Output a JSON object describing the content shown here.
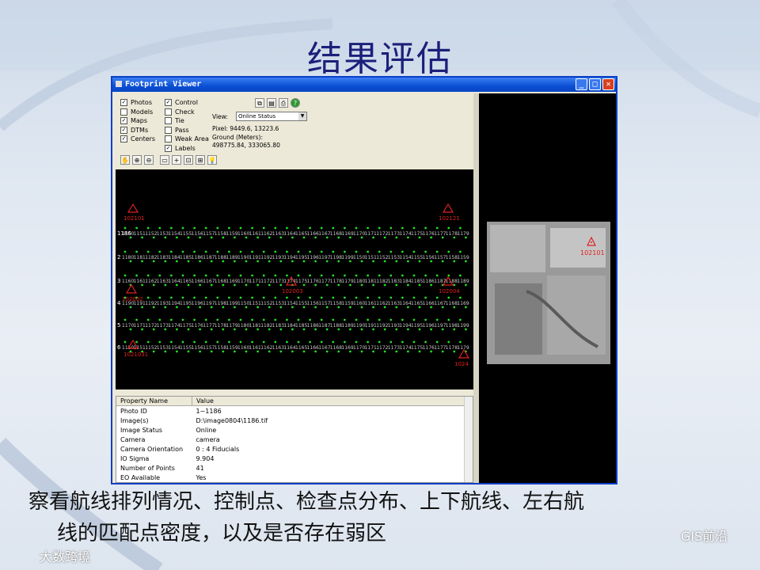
{
  "slide": {
    "title": "结果评估",
    "caption_line1": "察看航线排列情况、控制点、检查点分布、上下航线、左右航",
    "caption_line2": "线的匹配点密度，以及是否存在弱区",
    "watermark_left": "大数跨境",
    "watermark_right": "GIS前沿"
  },
  "window": {
    "title": "Footprint Viewer",
    "min": "_",
    "max": "□",
    "close": "✕"
  },
  "layers_col1": [
    {
      "label": "Photos",
      "checked": true
    },
    {
      "label": "Models",
      "checked": false
    },
    {
      "label": "Maps",
      "checked": true
    },
    {
      "label": "DTMs",
      "checked": true
    },
    {
      "label": "Centers",
      "checked": true
    }
  ],
  "layers_col2": [
    {
      "label": "Control",
      "checked": true
    },
    {
      "label": "Check",
      "checked": false
    },
    {
      "label": "Tie",
      "checked": false
    },
    {
      "label": "Pass",
      "checked": false
    },
    {
      "label": "Weak Area",
      "checked": false
    },
    {
      "label": "Labels",
      "checked": true
    }
  ],
  "view": {
    "label": "View:",
    "selected": "Online Status",
    "pixel": "Pixel: 9449.6, 13223.6",
    "ground_label": "Ground (Meters):",
    "ground_value": "498775.84, 333065.80"
  },
  "tools": [
    "hand-icon",
    "zoom-in-icon",
    "zoom-out-icon",
    "rect-icon",
    "crosshair-icon",
    "fit-icon",
    "fit-all-icon",
    "bulb-icon"
  ],
  "top_tools": [
    "copy-icon",
    "page-icon",
    "print-icon",
    "help-icon"
  ],
  "control_points": [
    "102101",
    "102121",
    "102002",
    "102003",
    "102004",
    "1021031",
    "1024"
  ],
  "row_labels": [
    "1186",
    "2",
    "3",
    "4",
    "5",
    "6"
  ],
  "right_pane_point": "102101",
  "properties": {
    "headers": [
      "Property Name",
      "Value"
    ],
    "rows": [
      [
        "Photo ID",
        "1~1186"
      ],
      [
        "Image(s)",
        "D:\\image0804\\1186.tif"
      ],
      [
        "Image Status",
        "Online"
      ],
      [
        "Camera",
        "camera"
      ],
      [
        "Camera Orientation",
        "0 : 4 Fiducials"
      ],
      [
        "IO Sigma",
        "9.904"
      ],
      [
        "Number of Points",
        "41"
      ],
      [
        "EO Available",
        "Yes"
      ]
    ]
  },
  "colors": {
    "title": "#1b1f7a",
    "point_green": "#22e022",
    "control_red": "#e02020"
  }
}
